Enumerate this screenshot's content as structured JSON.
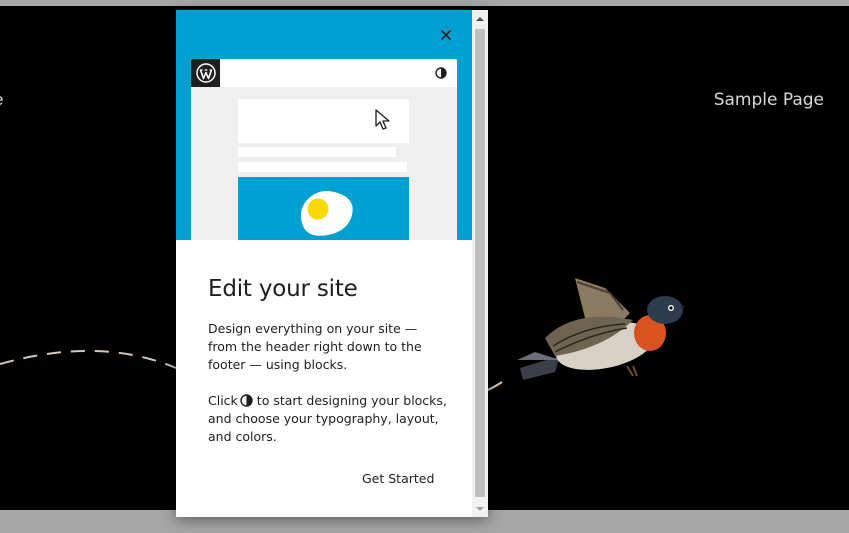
{
  "background_site": {
    "nav_left_fragment": "e",
    "nav_right": "Sample Page"
  },
  "guide": {
    "title": "Edit your site",
    "paragraph1": "Design everything on your site — from the header right down to the footer — using blocks.",
    "paragraph2_before": "Click",
    "paragraph2_after": "to start designing your blocks, and choose your typography, layout, and colors.",
    "primary_button": "Get Started",
    "icons": {
      "close": "close-icon",
      "logo": "wordpress-logo-icon",
      "styles": "contrast-icon",
      "cursor": "cursor-icon",
      "egg": "egg-icon"
    }
  },
  "colors": {
    "hero_blue": "#00a0d2",
    "canvas_bg": "#000000",
    "egg_yolk": "#f8da00"
  }
}
